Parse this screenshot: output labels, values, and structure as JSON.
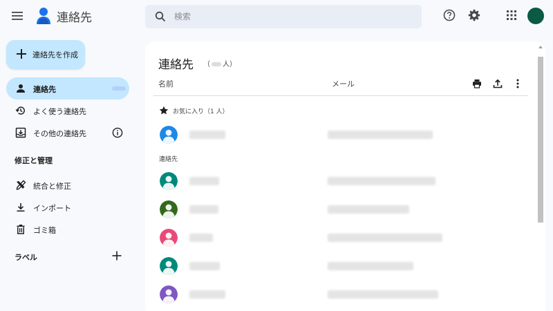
{
  "header": {
    "app_title": "連絡先",
    "search_placeholder": "検索",
    "icons": [
      "menu-icon",
      "contacts-logo",
      "search-icon",
      "help-icon",
      "settings-icon",
      "apps-icon",
      "account-avatar"
    ],
    "avatar_color": "#0b5a44"
  },
  "sidebar": {
    "create_label": "連絡先を作成",
    "items": [
      {
        "label": "連絡先",
        "icon": "person-icon",
        "active": true
      },
      {
        "label": "よく使う連絡先",
        "icon": "history-icon",
        "active": false
      },
      {
        "label": "その他の連絡先",
        "icon": "inbox-download-icon",
        "active": false
      }
    ],
    "manage_heading": "修正と管理",
    "manage_items": [
      {
        "label": "統合と修正",
        "icon": "merge-tools-icon"
      },
      {
        "label": "インポート",
        "icon": "download-icon"
      },
      {
        "label": "ゴミ箱",
        "icon": "trash-icon"
      }
    ],
    "labels_heading": "ラベル"
  },
  "main": {
    "title": "連絡先",
    "count_prefix": "（",
    "count_suffix": "人）",
    "col_name": "名前",
    "col_mail": "メール",
    "favorites_label": "お気に入り（1 人）",
    "contacts_label": "連絡先",
    "favorites": [
      {
        "avatar_color": "#1e88e5"
      }
    ],
    "contacts": [
      {
        "avatar_color": "#00897b"
      },
      {
        "avatar_color": "#33691e"
      },
      {
        "avatar_color": "#e84a78"
      },
      {
        "avatar_color": "#00897b"
      },
      {
        "avatar_color": "#7e57c2"
      }
    ]
  },
  "colors": {
    "accent": "#c2e7ff",
    "background": "#f7f9fc",
    "card": "#ffffff"
  }
}
